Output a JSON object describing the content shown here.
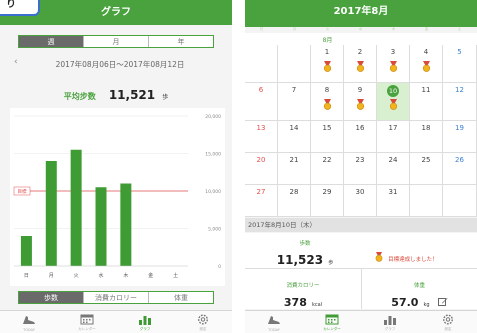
{
  "badge": {
    "text": "り"
  },
  "left": {
    "header_title": "グラフ",
    "period_tabs": [
      "週",
      "月",
      "年"
    ],
    "date_range": "2017年08月06日～2017年08月12日",
    "avg_label": "平均步数",
    "avg_value": "11,521",
    "avg_unit": "歩",
    "goal_label": "目標",
    "metric_tabs": [
      "歩数",
      "消費カロリー",
      "体重"
    ]
  },
  "chart_data": {
    "type": "bar",
    "categories": [
      "日",
      "月",
      "火",
      "水",
      "木",
      "金",
      "土"
    ],
    "values": [
      4000,
      14000,
      15500,
      10500,
      11000,
      0,
      0
    ],
    "ylim": [
      0,
      20000
    ],
    "yticks": [
      "0",
      "5,000",
      "10,000",
      "15,000",
      "20,000"
    ],
    "goal": 10000,
    "bar_color": "#3f9c35",
    "goal_color": "#e05050"
  },
  "right": {
    "header_title": "2017年8月",
    "weekdays": [
      "日",
      "月",
      "火",
      "水",
      "木",
      "金",
      "土"
    ],
    "month_label": "8月",
    "weeks": [
      [
        "",
        "",
        "1",
        "2",
        "3",
        "4",
        "5"
      ],
      [
        "6",
        "7",
        "8",
        "9",
        "10",
        "11",
        "12"
      ],
      [
        "13",
        "14",
        "15",
        "16",
        "17",
        "18",
        "19"
      ],
      [
        "20",
        "21",
        "22",
        "23",
        "24",
        "25",
        "26"
      ],
      [
        "27",
        "28",
        "29",
        "30",
        "31",
        "",
        ""
      ]
    ],
    "selected_date_label": "2017年8月10日（木）",
    "steps_label": "歩数",
    "steps_value": "11,523",
    "steps_unit": "歩",
    "achieved_text": "目標達成しました！",
    "kcal_label": "消費カロリー",
    "kcal_value": "378",
    "kcal_unit": "kcal",
    "weight_label": "体重",
    "weight_value": "57.0",
    "weight_unit": "kg"
  },
  "tabbar": {
    "today": "TODAY",
    "calendar": "カレンダー",
    "graph": "グラフ",
    "settings": "設定"
  }
}
